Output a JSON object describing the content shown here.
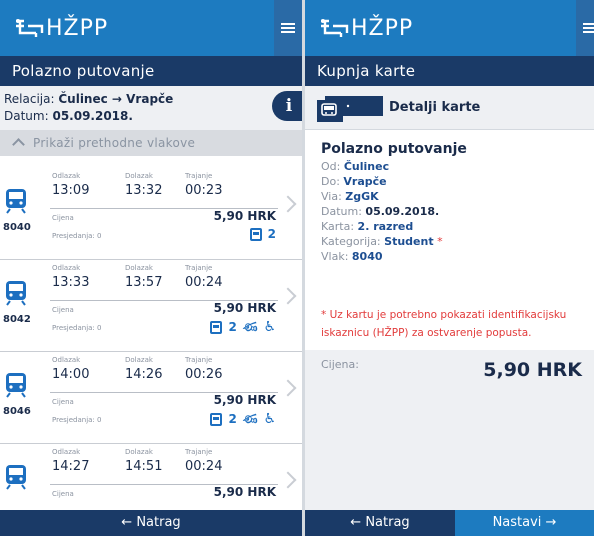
{
  "brand": "HŽPP",
  "left": {
    "title": "Polazno putovanje",
    "relacija_label": "Relacija:",
    "relacija_value": "Čulinec → Vrapče",
    "datum_label": "Datum:",
    "datum_value": "05.09.2018.",
    "info_icon": "i",
    "prev_trains": "Prikaži prethodne vlakove",
    "labels": {
      "departure": "Odlazak",
      "arrival": "Dolazak",
      "duration": "Trajanje",
      "price": "Cijena"
    },
    "trains": [
      {
        "number": "8040",
        "departure": "13:09",
        "arrival": "13:32",
        "duration": "00:23",
        "price": "5,90 HRK",
        "transfers": "Presjedanja: 0",
        "class": "2",
        "bike": false,
        "wheelchair": false
      },
      {
        "number": "8042",
        "departure": "13:33",
        "arrival": "13:57",
        "duration": "00:24",
        "price": "5,90 HRK",
        "transfers": "Presjedanja: 0",
        "class": "2",
        "bike": true,
        "wheelchair": true
      },
      {
        "number": "8046",
        "departure": "14:00",
        "arrival": "14:26",
        "duration": "00:26",
        "price": "5,90 HRK",
        "transfers": "Presjedanja: 0",
        "class": "2",
        "bike": true,
        "wheelchair": true
      },
      {
        "number": "",
        "departure": "14:27",
        "arrival": "14:51",
        "duration": "00:24",
        "price": "5,90 HRK",
        "transfers": "",
        "class": "",
        "bike": false,
        "wheelchair": false
      }
    ],
    "back": "← Natrag"
  },
  "right": {
    "title": "Kupnja karte",
    "ticket_title": "Detalji karte",
    "heading": "Polazno putovanje",
    "od_label": "Od:",
    "od_value": "Čulinec",
    "do_label": "Do:",
    "do_value": "Vrapče",
    "via_label": "Via:",
    "via_value": "ZgGK",
    "datum_label": "Datum:",
    "datum_value": "05.09.2018.",
    "karta_label": "Karta:",
    "karta_value": "2. razred",
    "kategorija_label": "Kategorija:",
    "kategorija_value": "Student",
    "required_mark": "*",
    "vlak_label": "Vlak:",
    "vlak_value": "8040",
    "notice": "* Uz kartu je potrebno pokazati identifikacijsku iskaznicu (HŽPP) za ostvarenje popusta.",
    "price_label": "Cijena:",
    "price_value": "5,90 HRK",
    "back": "← Natrag",
    "next": "Nastavi →"
  },
  "icons": [
    "hzpp-logo-icon",
    "menu-icon",
    "info-icon",
    "chevron-up-icon",
    "train-icon",
    "chevron-right-icon",
    "seat-icon",
    "bike-icon",
    "wheelchair-icon",
    "ticket-icon"
  ],
  "colors": {
    "primary": "#1d7bc0",
    "dark": "#1a3a67",
    "accent_red": "#e23b3b"
  }
}
